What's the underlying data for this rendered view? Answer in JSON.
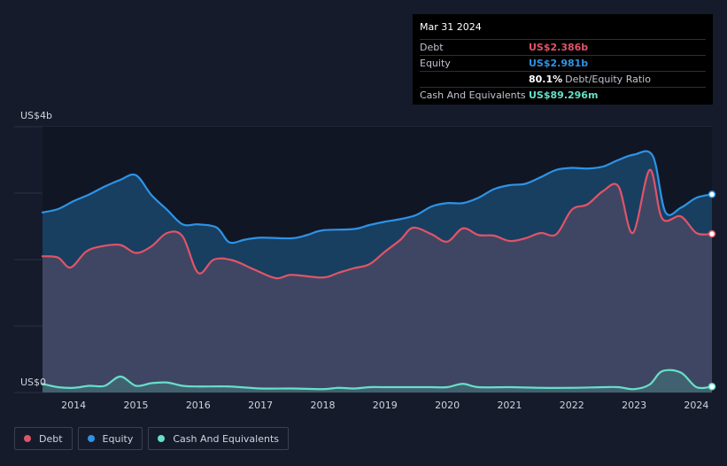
{
  "tooltip": {
    "date": "Mar 31 2024",
    "debt_label": "Debt",
    "debt_value": "US$2.386b",
    "equity_label": "Equity",
    "equity_value": "US$2.981b",
    "ratio_value": "80.1%",
    "ratio_label": "Debt/Equity Ratio",
    "cash_label": "Cash And Equivalents",
    "cash_value": "US$89.296m"
  },
  "legend": {
    "debt": "Debt",
    "equity": "Equity",
    "cash": "Cash And Equivalents"
  },
  "colors": {
    "debt": "#e05468",
    "equity": "#2d93e6",
    "cash": "#66e0c8",
    "background": "#151b2a"
  },
  "chart_data": {
    "type": "area",
    "ylabel_top": "US$4b",
    "ylabel_bottom": "US$0",
    "ylim": [
      0,
      4
    ],
    "xlim": [
      2013.5,
      2024.25
    ],
    "x_ticks": [
      "2014",
      "2015",
      "2016",
      "2017",
      "2018",
      "2019",
      "2020",
      "2021",
      "2022",
      "2023",
      "2024"
    ],
    "grid": true,
    "legend_position": "bottom-left",
    "series": [
      {
        "name": "Debt",
        "points": [
          [
            2013.5,
            2.05
          ],
          [
            2013.75,
            2.03
          ],
          [
            2013.95,
            1.88
          ],
          [
            2014.2,
            2.12
          ],
          [
            2014.45,
            2.2
          ],
          [
            2014.75,
            2.22
          ],
          [
            2015.0,
            2.1
          ],
          [
            2015.25,
            2.2
          ],
          [
            2015.5,
            2.4
          ],
          [
            2015.75,
            2.35
          ],
          [
            2016.0,
            1.8
          ],
          [
            2016.25,
            2.0
          ],
          [
            2016.55,
            1.99
          ],
          [
            2016.9,
            1.85
          ],
          [
            2017.25,
            1.72
          ],
          [
            2017.5,
            1.77
          ],
          [
            2018.0,
            1.73
          ],
          [
            2018.25,
            1.8
          ],
          [
            2018.5,
            1.87
          ],
          [
            2018.75,
            1.93
          ],
          [
            2019.0,
            2.12
          ],
          [
            2019.25,
            2.3
          ],
          [
            2019.45,
            2.48
          ],
          [
            2019.75,
            2.38
          ],
          [
            2020.0,
            2.27
          ],
          [
            2020.25,
            2.47
          ],
          [
            2020.5,
            2.37
          ],
          [
            2020.75,
            2.36
          ],
          [
            2021.0,
            2.28
          ],
          [
            2021.25,
            2.32
          ],
          [
            2021.5,
            2.4
          ],
          [
            2021.75,
            2.38
          ],
          [
            2022.0,
            2.75
          ],
          [
            2022.25,
            2.83
          ],
          [
            2022.5,
            3.03
          ],
          [
            2022.75,
            3.1
          ],
          [
            2022.98,
            2.4
          ],
          [
            2023.25,
            3.35
          ],
          [
            2023.45,
            2.62
          ],
          [
            2023.75,
            2.65
          ],
          [
            2024.0,
            2.4
          ],
          [
            2024.25,
            2.386
          ]
        ]
      },
      {
        "name": "Equity",
        "points": [
          [
            2013.5,
            2.71
          ],
          [
            2013.75,
            2.76
          ],
          [
            2014.0,
            2.88
          ],
          [
            2014.25,
            2.98
          ],
          [
            2014.5,
            3.1
          ],
          [
            2014.75,
            3.2
          ],
          [
            2015.0,
            3.27
          ],
          [
            2015.25,
            2.97
          ],
          [
            2015.5,
            2.75
          ],
          [
            2015.75,
            2.53
          ],
          [
            2016.0,
            2.53
          ],
          [
            2016.3,
            2.48
          ],
          [
            2016.5,
            2.26
          ],
          [
            2016.75,
            2.3
          ],
          [
            2017.0,
            2.33
          ],
          [
            2017.5,
            2.32
          ],
          [
            2017.75,
            2.37
          ],
          [
            2018.0,
            2.44
          ],
          [
            2018.5,
            2.46
          ],
          [
            2018.75,
            2.52
          ],
          [
            2019.0,
            2.57
          ],
          [
            2019.25,
            2.61
          ],
          [
            2019.5,
            2.67
          ],
          [
            2019.75,
            2.8
          ],
          [
            2020.0,
            2.85
          ],
          [
            2020.25,
            2.85
          ],
          [
            2020.5,
            2.93
          ],
          [
            2020.75,
            3.06
          ],
          [
            2021.0,
            3.12
          ],
          [
            2021.25,
            3.14
          ],
          [
            2021.5,
            3.24
          ],
          [
            2021.75,
            3.35
          ],
          [
            2022.0,
            3.38
          ],
          [
            2022.25,
            3.37
          ],
          [
            2022.5,
            3.4
          ],
          [
            2022.75,
            3.5
          ],
          [
            2023.0,
            3.58
          ],
          [
            2023.3,
            3.56
          ],
          [
            2023.5,
            2.72
          ],
          [
            2023.75,
            2.78
          ],
          [
            2024.0,
            2.93
          ],
          [
            2024.25,
            2.981
          ]
        ]
      },
      {
        "name": "Cash And Equivalents",
        "points": [
          [
            2013.5,
            0.13
          ],
          [
            2013.75,
            0.08
          ],
          [
            2014.0,
            0.07
          ],
          [
            2014.25,
            0.1
          ],
          [
            2014.5,
            0.1
          ],
          [
            2014.75,
            0.24
          ],
          [
            2015.0,
            0.1
          ],
          [
            2015.25,
            0.14
          ],
          [
            2015.5,
            0.15
          ],
          [
            2015.75,
            0.1
          ],
          [
            2016.0,
            0.09
          ],
          [
            2016.5,
            0.09
          ],
          [
            2017.0,
            0.06
          ],
          [
            2017.5,
            0.06
          ],
          [
            2018.0,
            0.05
          ],
          [
            2018.25,
            0.07
          ],
          [
            2018.5,
            0.06
          ],
          [
            2018.75,
            0.08
          ],
          [
            2019.0,
            0.08
          ],
          [
            2019.5,
            0.08
          ],
          [
            2019.75,
            0.08
          ],
          [
            2020.0,
            0.08
          ],
          [
            2020.25,
            0.13
          ],
          [
            2020.5,
            0.08
          ],
          [
            2021.0,
            0.08
          ],
          [
            2021.5,
            0.07
          ],
          [
            2022.0,
            0.07
          ],
          [
            2022.5,
            0.08
          ],
          [
            2022.75,
            0.08
          ],
          [
            2023.0,
            0.05
          ],
          [
            2023.25,
            0.12
          ],
          [
            2023.45,
            0.32
          ],
          [
            2023.75,
            0.3
          ],
          [
            2024.0,
            0.08
          ],
          [
            2024.25,
            0.089
          ]
        ]
      }
    ]
  }
}
